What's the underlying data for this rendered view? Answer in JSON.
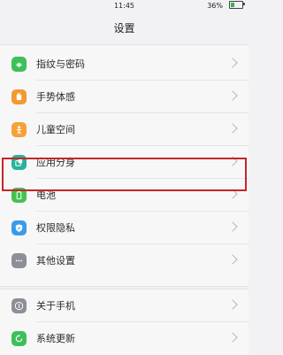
{
  "status_bar": {
    "time": "11:45",
    "battery_percent": "36%",
    "battery_level": 0.36,
    "charging": true
  },
  "header": {
    "title": "设置"
  },
  "groups": [
    {
      "items": [
        {
          "label": "指纹与密码",
          "icon": "fingerprint-icon",
          "color": "#3fbf5a"
        },
        {
          "label": "手势体感",
          "icon": "hand-gesture-icon",
          "color": "#f39a2e"
        },
        {
          "label": "儿童空间",
          "icon": "child-icon",
          "color": "#f5a23a"
        },
        {
          "label": "应用分身",
          "icon": "app-clone-icon",
          "color": "#29b39a"
        },
        {
          "label": "电池",
          "icon": "battery-icon",
          "color": "#44c24f",
          "highlighted": true
        },
        {
          "label": "权限隐私",
          "icon": "shield-icon",
          "color": "#3c9be6"
        },
        {
          "label": "其他设置",
          "icon": "more-dots-icon",
          "color": "#8c8f96"
        }
      ]
    },
    {
      "items": [
        {
          "label": "关于手机",
          "icon": "info-icon",
          "color": "#8c8f96"
        },
        {
          "label": "系统更新",
          "icon": "system-update-icon",
          "color": "#3fbf5a"
        }
      ]
    }
  ],
  "colors": {
    "highlight_border": "#c7252b",
    "background": "#f2f2f4"
  }
}
